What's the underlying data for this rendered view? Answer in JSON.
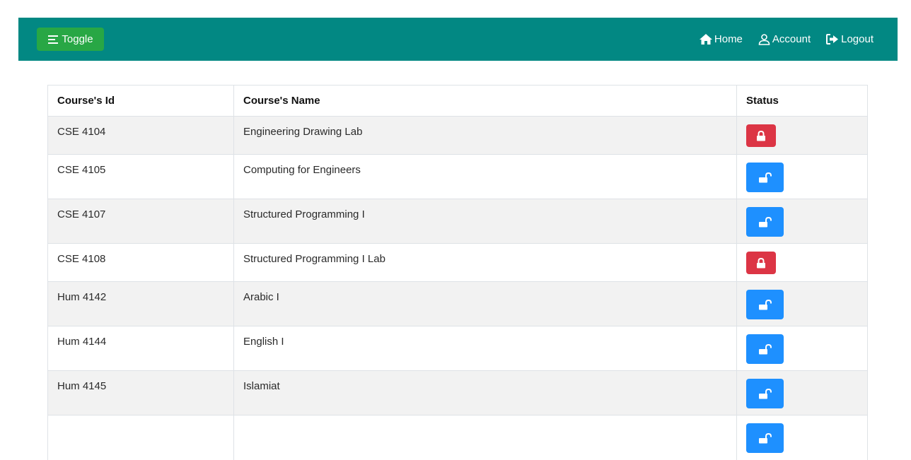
{
  "navbar": {
    "background": "#028883",
    "toggle_label": "Toggle",
    "toggle_color": "#28a745",
    "links": {
      "home": "Home",
      "account": "Account",
      "logout": "Logout"
    }
  },
  "table": {
    "headers": {
      "id": "Course's Id",
      "name": "Course's Name",
      "status": "Status"
    },
    "rows": [
      {
        "id": "CSE 4104",
        "name": "Engineering Drawing Lab",
        "status": "locked",
        "icon": "lock-icon"
      },
      {
        "id": "CSE 4105",
        "name": "Computing for Engineers",
        "status": "unlocked",
        "icon": "unlock-icon"
      },
      {
        "id": "CSE 4107",
        "name": "Structured Programming I",
        "status": "unlocked",
        "icon": "unlock-icon"
      },
      {
        "id": "CSE 4108",
        "name": "Structured Programming I Lab",
        "status": "locked",
        "icon": "lock-icon"
      },
      {
        "id": "Hum 4142",
        "name": "Arabic I",
        "status": "unlocked",
        "icon": "unlock-icon"
      },
      {
        "id": "Hum 4144",
        "name": "English I",
        "status": "unlocked",
        "icon": "unlock-icon"
      },
      {
        "id": "Hum 4145",
        "name": "Islamiat",
        "status": "unlocked",
        "icon": "unlock-icon"
      },
      {
        "id": "",
        "name": "",
        "status": "unlocked",
        "icon": "unlock-icon"
      }
    ],
    "status_colors": {
      "locked": "#dc3545",
      "unlocked": "#1e90ff"
    }
  }
}
